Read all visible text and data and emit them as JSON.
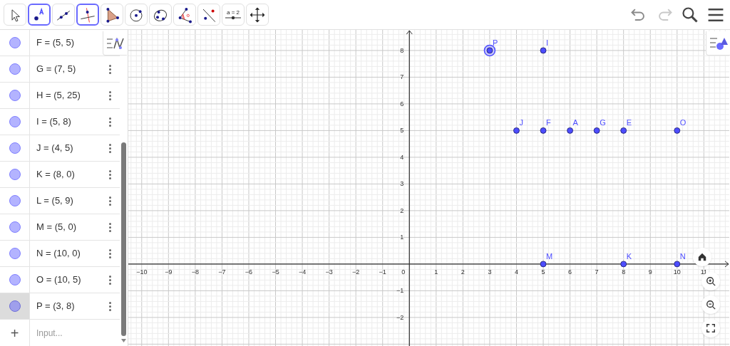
{
  "toolbar": {
    "tools": [
      {
        "kind": "move",
        "selected": false
      },
      {
        "kind": "point",
        "selected": true
      },
      {
        "kind": "line",
        "selected": false
      },
      {
        "kind": "perpendicular",
        "selected": true
      },
      {
        "kind": "polygon",
        "selected": false
      },
      {
        "kind": "circle",
        "selected": false
      },
      {
        "kind": "conic",
        "selected": false
      },
      {
        "kind": "angle",
        "selected": false
      },
      {
        "kind": "reflect",
        "selected": false
      },
      {
        "kind": "slider",
        "selected": false,
        "label": "a = 2"
      },
      {
        "kind": "move_view",
        "selected": false
      }
    ],
    "actions": [
      {
        "kind": "undo",
        "disabled": false
      },
      {
        "kind": "redo",
        "disabled": true
      },
      {
        "kind": "search",
        "disabled": false
      },
      {
        "kind": "menu",
        "disabled": false
      }
    ]
  },
  "algebra": {
    "items": [
      {
        "label": "F = (5, 5)",
        "selected": false,
        "menu": false
      },
      {
        "label": "G = (7, 5)",
        "selected": false,
        "menu": true
      },
      {
        "label": "H = (5, 25)",
        "selected": false,
        "menu": true
      },
      {
        "label": "I = (5, 8)",
        "selected": false,
        "menu": true
      },
      {
        "label": "J = (4, 5)",
        "selected": false,
        "menu": true
      },
      {
        "label": "K = (8, 0)",
        "selected": false,
        "menu": true
      },
      {
        "label": "L = (5, 9)",
        "selected": false,
        "menu": true
      },
      {
        "label": "M = (5, 0)",
        "selected": false,
        "menu": true
      },
      {
        "label": "N = (10, 0)",
        "selected": false,
        "menu": true
      },
      {
        "label": "O = (10, 5)",
        "selected": false,
        "menu": true
      },
      {
        "label": "P = (3, 8)",
        "selected": true,
        "menu": true
      }
    ],
    "input": {
      "icon": "+",
      "placeholder": "Input..."
    }
  },
  "graphics": {
    "chart_data": {
      "type": "scatter",
      "x": [
        3,
        5,
        4,
        5,
        6,
        7,
        8,
        10,
        5,
        8,
        10
      ],
      "series": [
        {
          "color": "#4d4dff",
          "values": [
            8,
            8,
            5,
            5,
            5,
            5,
            5,
            5,
            0,
            0,
            0
          ]
        }
      ],
      "grid": true,
      "xlim": [
        -10.5,
        11.95
      ],
      "ylim": [
        -3.07,
        8.77
      ],
      "xticks": [
        {
          "value": -10,
          "label": "−10"
        },
        {
          "value": -9,
          "label": "−9"
        },
        {
          "value": -8,
          "label": "−8"
        },
        {
          "value": -7,
          "label": "−7"
        },
        {
          "value": -6,
          "label": "−6"
        },
        {
          "value": -5,
          "label": "−5"
        },
        {
          "value": -4,
          "label": "−4"
        },
        {
          "value": -3,
          "label": "−3"
        },
        {
          "value": -2,
          "label": "−2"
        },
        {
          "value": -1,
          "label": "−1"
        },
        {
          "value": 1,
          "label": "1"
        },
        {
          "value": 2,
          "label": "2"
        },
        {
          "value": 3,
          "label": "3"
        },
        {
          "value": 4,
          "label": "4"
        },
        {
          "value": 5,
          "label": "5"
        },
        {
          "value": 6,
          "label": "6"
        },
        {
          "value": 7,
          "label": "7"
        },
        {
          "value": 8,
          "label": "8"
        },
        {
          "value": 9,
          "label": "9"
        },
        {
          "value": 10,
          "label": "10"
        },
        {
          "value": 11,
          "label": "11"
        }
      ],
      "yticks": [
        {
          "value": -2,
          "label": "−2"
        },
        {
          "value": -1,
          "label": "−1"
        },
        {
          "value": 1,
          "label": "1"
        },
        {
          "value": 2,
          "label": "2"
        },
        {
          "value": 3,
          "label": "3"
        },
        {
          "value": 4,
          "label": "4"
        },
        {
          "value": 5,
          "label": "5"
        },
        {
          "value": 6,
          "label": "6"
        },
        {
          "value": 7,
          "label": "7"
        },
        {
          "value": 8,
          "label": "8"
        }
      ],
      "annotations": [
        {
          "text": "P",
          "x": 3,
          "y": 8
        },
        {
          "text": "I",
          "x": 5,
          "y": 8
        },
        {
          "text": "J",
          "x": 4,
          "y": 5
        },
        {
          "text": "F",
          "x": 5,
          "y": 5
        },
        {
          "text": "A",
          "x": 6,
          "y": 5
        },
        {
          "text": "G",
          "x": 7,
          "y": 5
        },
        {
          "text": "E",
          "x": 8,
          "y": 5
        },
        {
          "text": "O",
          "x": 10,
          "y": 5
        },
        {
          "text": "M",
          "x": 5,
          "y": 0
        },
        {
          "text": "K",
          "x": 8,
          "y": 0
        },
        {
          "text": "N",
          "x": 10,
          "y": 0
        }
      ]
    },
    "origin_label": "0",
    "point_states": [
      {
        "selected": true
      },
      {
        "selected": false
      },
      {
        "selected": false
      },
      {
        "selected": false
      },
      {
        "selected": false
      },
      {
        "selected": false
      },
      {
        "selected": false
      },
      {
        "selected": false
      },
      {
        "selected": false
      },
      {
        "selected": false
      },
      {
        "selected": false
      }
    ]
  }
}
